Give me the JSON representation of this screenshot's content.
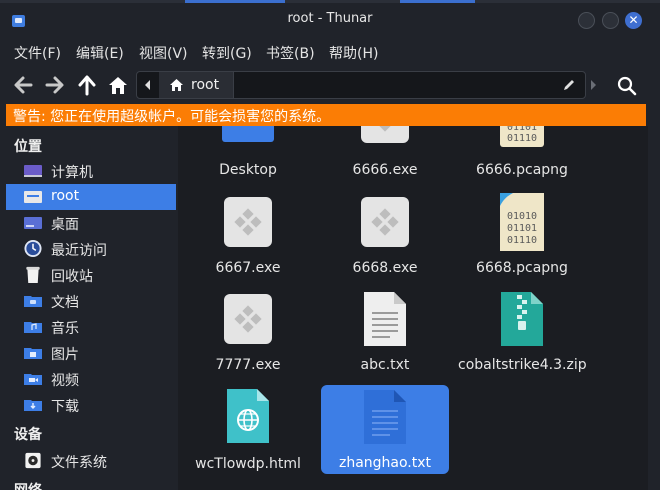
{
  "window": {
    "title": "root - Thunar"
  },
  "menu": [
    "文件(F)",
    "编辑(E)",
    "视图(V)",
    "转到(G)",
    "书签(B)",
    "帮助(H)"
  ],
  "path": {
    "current": "root"
  },
  "warning": "警告: 您正在使用超级帐户。可能会损害您的系统。",
  "sidebar": {
    "section_places": "位置",
    "places": [
      {
        "label": "计算机",
        "icon": "computer-icon"
      },
      {
        "label": "root",
        "icon": "home-folder-icon",
        "selected": true
      },
      {
        "label": "桌面",
        "icon": "desktop-folder-icon"
      },
      {
        "label": "最近访问",
        "icon": "recent-icon"
      },
      {
        "label": "回收站",
        "icon": "trash-icon"
      },
      {
        "label": "文档",
        "icon": "documents-folder-icon"
      },
      {
        "label": "音乐",
        "icon": "music-folder-icon"
      },
      {
        "label": "图片",
        "icon": "pictures-folder-icon"
      },
      {
        "label": "视频",
        "icon": "videos-folder-icon"
      },
      {
        "label": "下载",
        "icon": "downloads-folder-icon"
      }
    ],
    "section_devices": "设备",
    "devices": [
      {
        "label": "文件系统",
        "icon": "drive-icon"
      }
    ],
    "section_network": "网络"
  },
  "files": [
    {
      "name": "Desktop",
      "icon": "folder-icon"
    },
    {
      "name": "6666.exe",
      "icon": "exe-icon"
    },
    {
      "name": "6666.pcapng",
      "icon": "binary-file-icon"
    },
    {
      "name": "6667.exe",
      "icon": "exe-icon"
    },
    {
      "name": "6668.exe",
      "icon": "exe-icon"
    },
    {
      "name": "6668.pcapng",
      "icon": "binary-file-icon"
    },
    {
      "name": "7777.exe",
      "icon": "exe-icon"
    },
    {
      "name": "abc.txt",
      "icon": "text-file-icon"
    },
    {
      "name": "cobaltstrike4.3.zip",
      "icon": "zip-file-icon"
    },
    {
      "name": "wcTlowdp.html",
      "icon": "html-file-icon"
    },
    {
      "name": "zhanghao.txt",
      "icon": "text-file-icon",
      "selected": true
    }
  ],
  "colors": {
    "accent": "#3d7ee6",
    "warning": "#fb7d05",
    "background": "#20232a"
  }
}
